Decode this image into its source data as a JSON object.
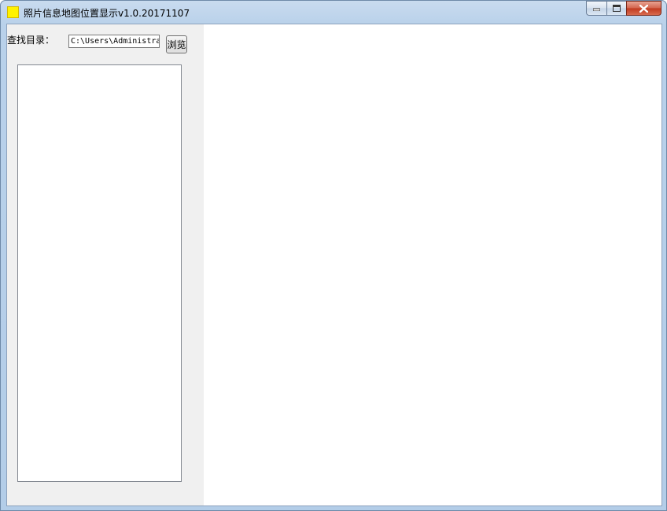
{
  "window": {
    "title": "照片信息地图位置显示v1.0.20171107",
    "app_icon": "photo-app-icon",
    "buttons": {
      "minimize": "minimize-icon",
      "maximize": "maximize-icon",
      "close": "close-icon"
    }
  },
  "search": {
    "label": "查找目录：",
    "path_value": "C:\\Users\\Administrator",
    "browse_label": "浏览"
  },
  "file_list": {
    "items": []
  },
  "colors": {
    "panel_bg": "#f0f0f0",
    "titlebar": "#b9d1ea",
    "close_button": "#c0391e"
  }
}
